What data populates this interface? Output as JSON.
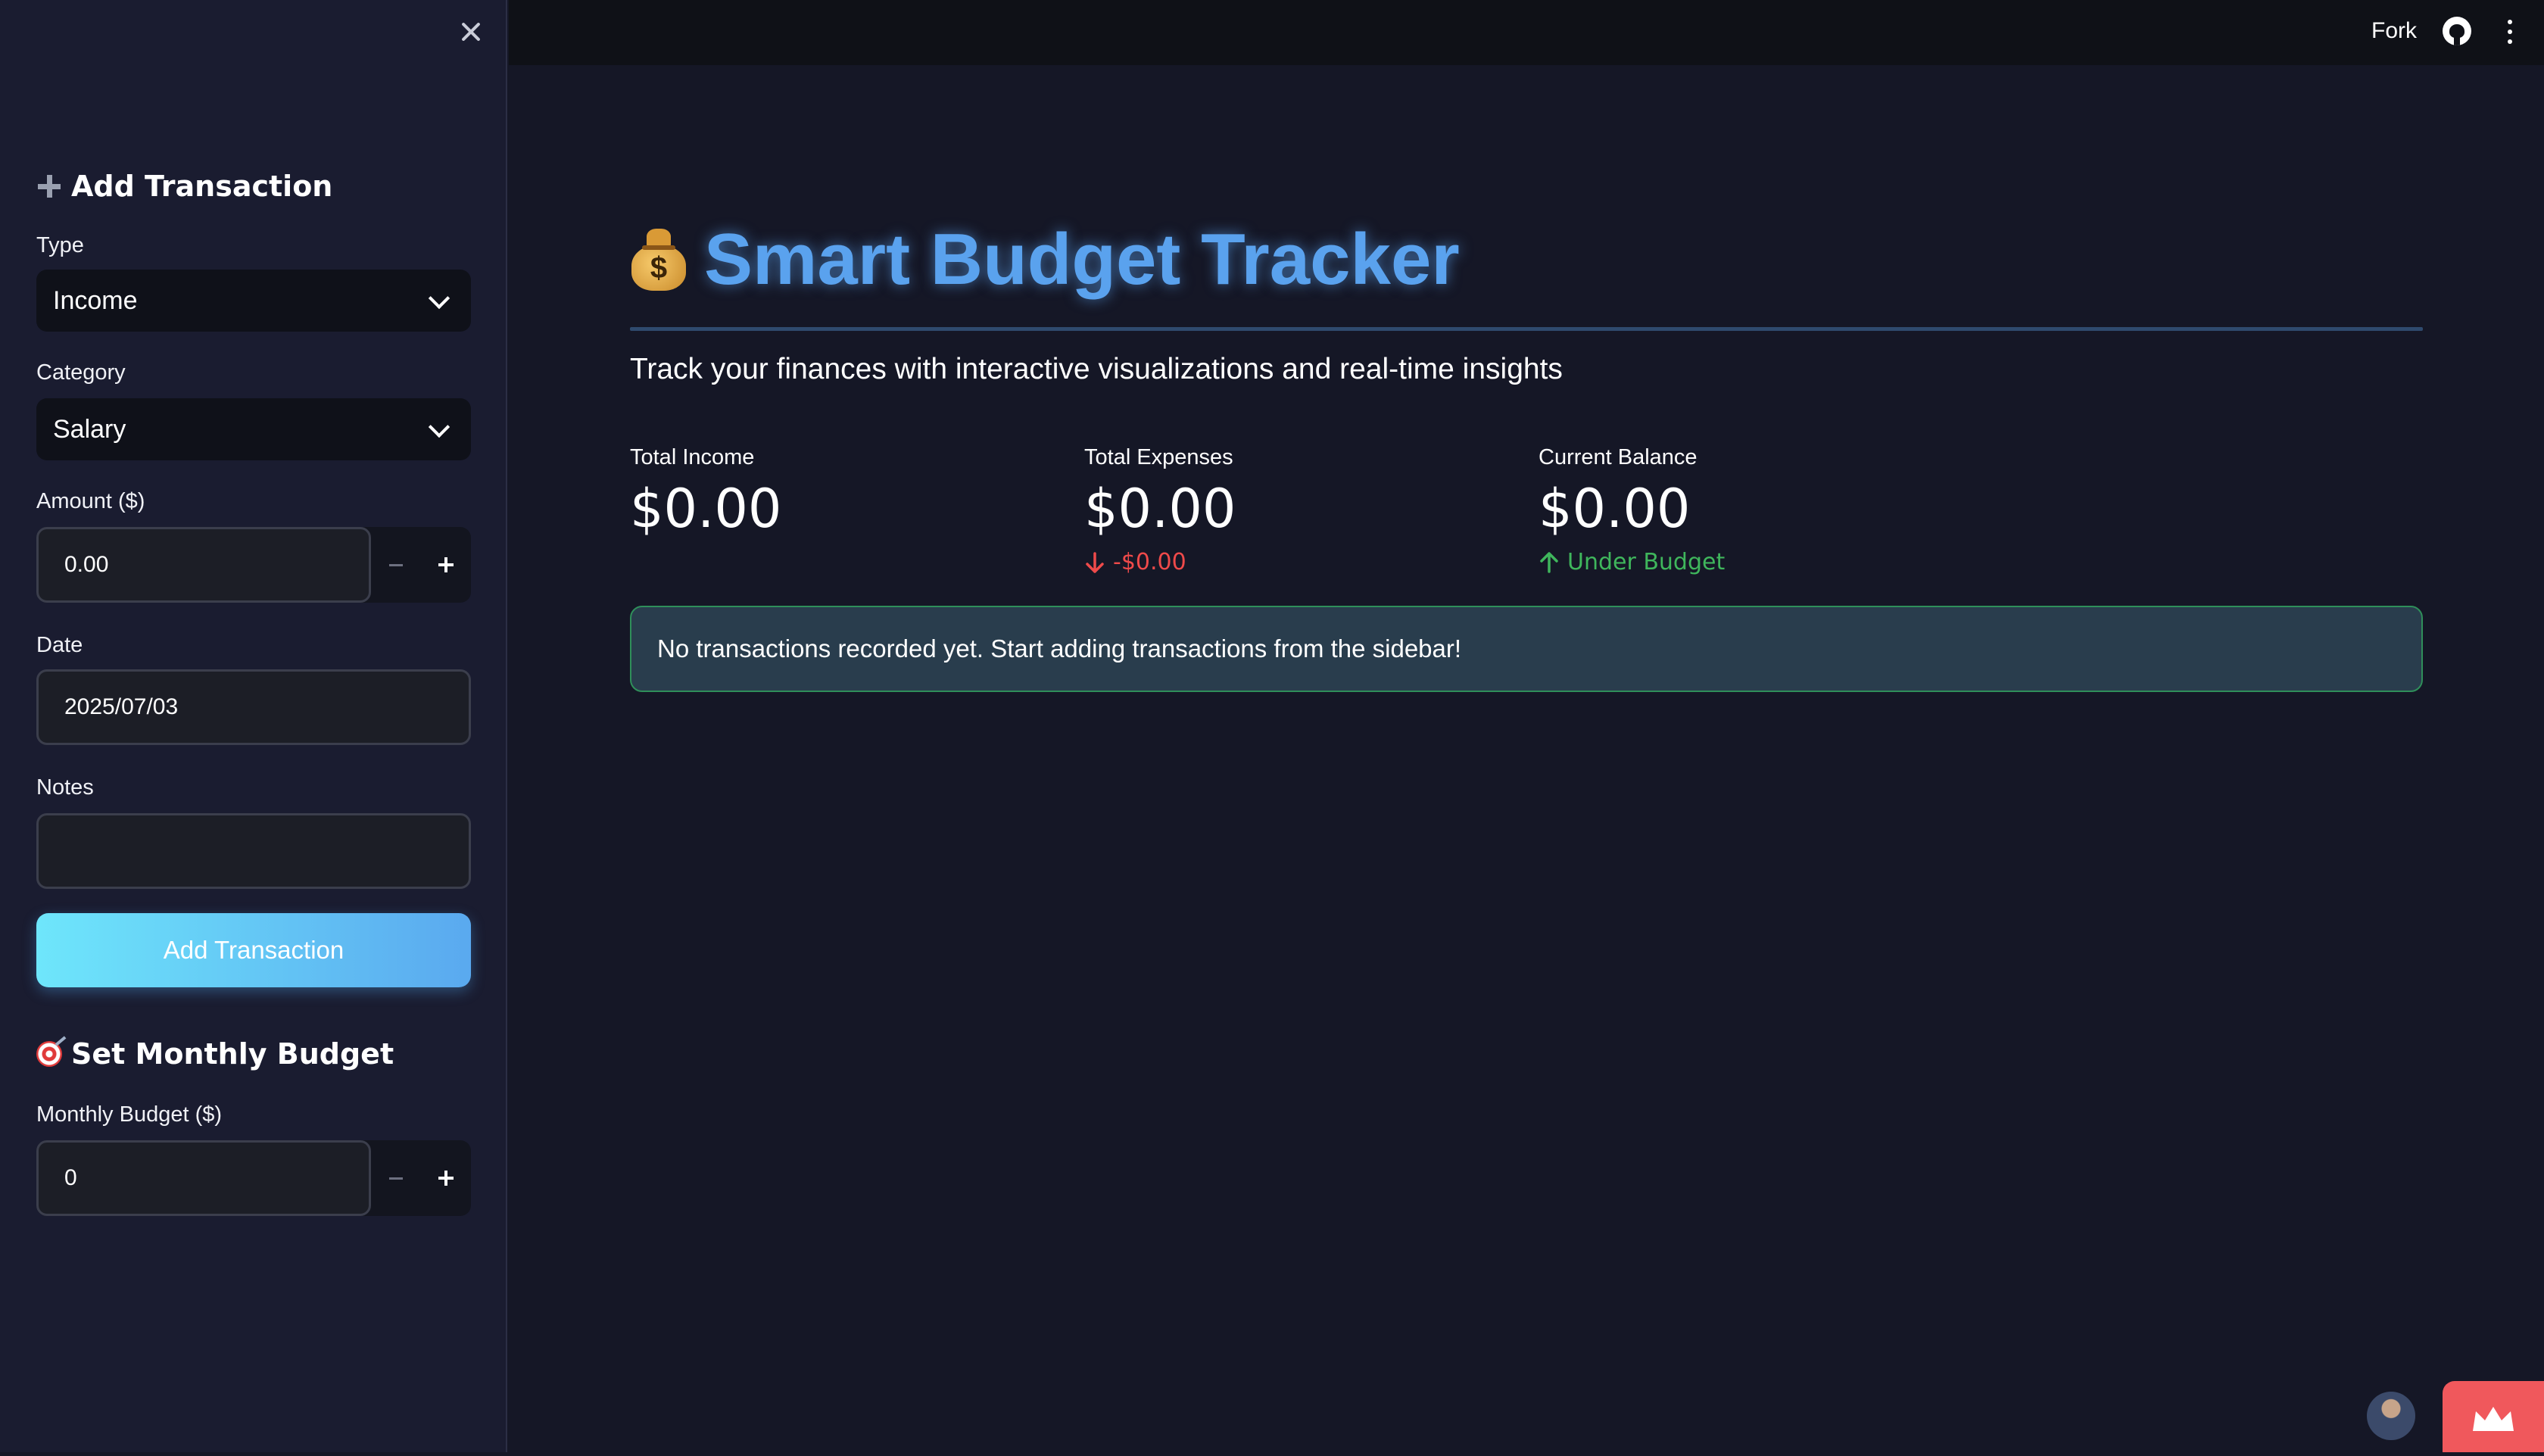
{
  "topbar": {
    "fork_label": "Fork",
    "github_icon": "github-icon",
    "menu_icon": "more-vertical-icon"
  },
  "sidebar": {
    "add_transaction": {
      "heading": "Add Transaction",
      "type_label": "Type",
      "type_value": "Income",
      "category_label": "Category",
      "category_value": "Salary",
      "amount_label": "Amount ($)",
      "amount_value": "0.00",
      "date_label": "Date",
      "date_value": "2025/07/03",
      "notes_label": "Notes",
      "notes_value": "",
      "submit_label": "Add Transaction"
    },
    "budget": {
      "heading": "Set Monthly Budget",
      "budget_label": "Monthly Budget ($)",
      "budget_value": "0"
    }
  },
  "main": {
    "title": "Smart Budget Tracker",
    "subtitle": "Track your finances with interactive visualizations and real-time insights",
    "metrics": [
      {
        "label": "Total Income",
        "value": "$0.00"
      },
      {
        "label": "Total Expenses",
        "value": "$0.00",
        "delta": "-$0.00"
      },
      {
        "label": "Current Balance",
        "value": "$0.00",
        "delta": "Under Budget"
      }
    ],
    "info_message": "No transactions recorded yet. Start adding transactions from the sidebar!"
  },
  "colors": {
    "accent": "#5aa2ee",
    "button_gradient_start": "#6ee6fb",
    "button_gradient_end": "#5aa9ef",
    "negative": "#ef4a4a",
    "positive": "#3fb65c",
    "info_border": "#2f8f5a"
  }
}
